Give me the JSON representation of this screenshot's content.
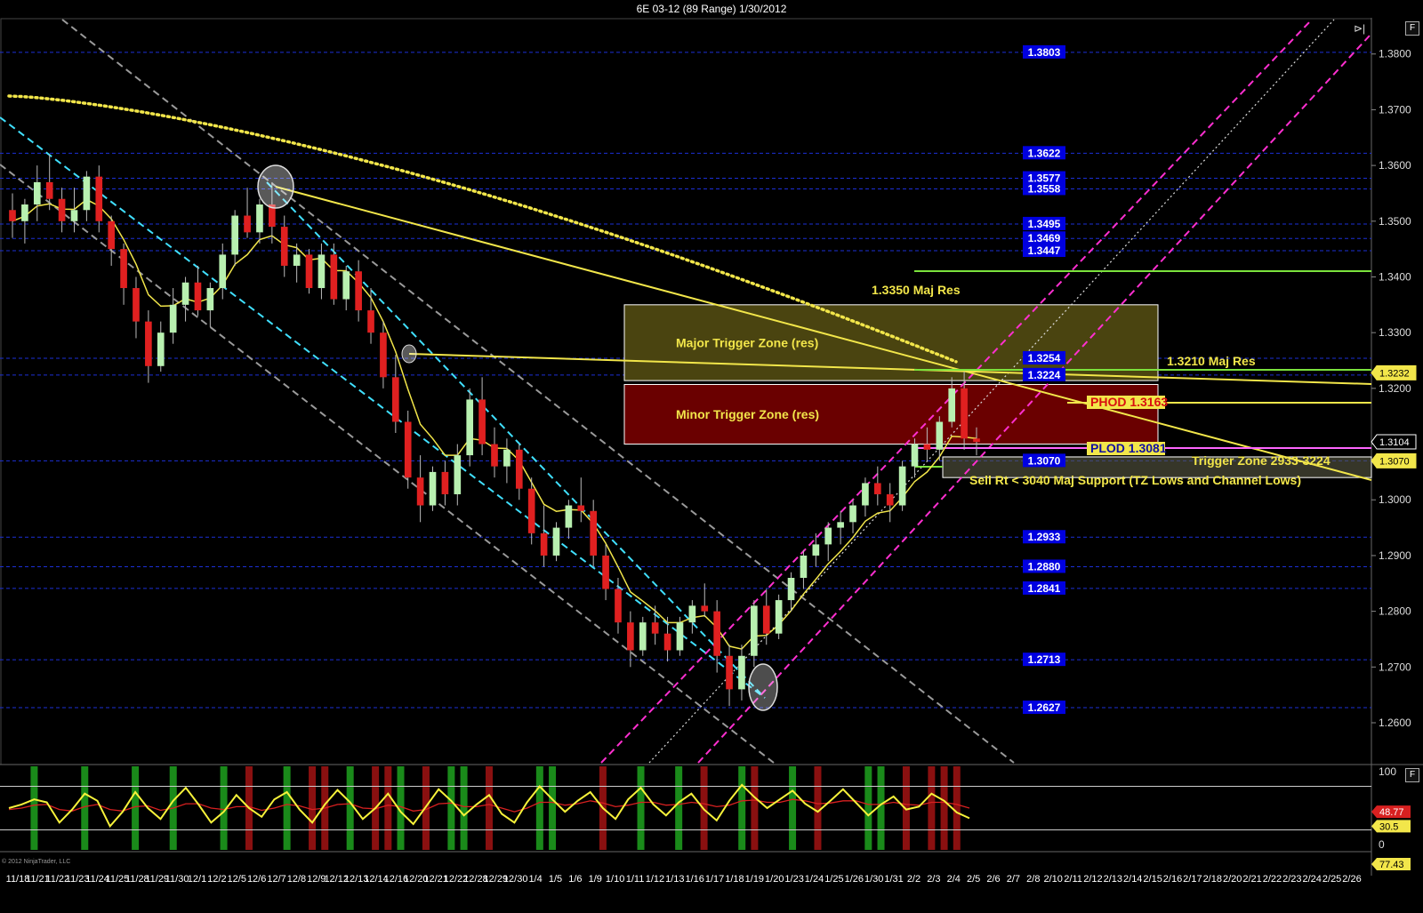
{
  "window": {
    "title": "6E 03-12 (89 Range)  1/30/2012",
    "f_button": "F",
    "copyright": "© 2012 NinjaTrader, LLC"
  },
  "colors": {
    "background": "#000000",
    "level_line": "#1c2fd6",
    "level_box": "#0000e0",
    "bull_candle": "#b8f0b0",
    "bear_candle": "#e02020",
    "sma_dotted": "#f2e64a",
    "ema_line": "#f2e64a",
    "channel_magenta": "#ff2fd0",
    "channel_cyan": "#40e0ff",
    "channel_gray": "#9a9a9a",
    "green_line": "#7be23c",
    "major_zone": "#4a4410",
    "minor_zone": "#6a0000",
    "osc_yellow": "#f7f23a",
    "osc_red": "#d82020",
    "osc_bar_green": "#1a8a1a",
    "osc_bar_red": "#8a1010"
  },
  "chart_data": {
    "type": "candlestick",
    "instrument": "6E 03-12",
    "ylim": [
      1.2525,
      1.3865
    ],
    "y_ticks": [
      "1.3800",
      "1.3700",
      "1.3600",
      "1.3500",
      "1.3400",
      "1.3300",
      "1.3200",
      "1.3100",
      "1.3000",
      "1.2900",
      "1.2800",
      "1.2700",
      "1.2600"
    ],
    "x_labels": [
      "11/18",
      "11/21",
      "11/22",
      "11/23",
      "11/24",
      "11/25",
      "11/28",
      "11/29",
      "11/30",
      "12/1",
      "12/2",
      "12/5",
      "12/6",
      "12/7",
      "12/8",
      "12/9",
      "12/12",
      "12/13",
      "12/14",
      "12/16",
      "12/20",
      "12/21",
      "12/22",
      "12/28",
      "12/29",
      "12/30",
      "1/4",
      "1/5",
      "1/6",
      "1/9",
      "1/10",
      "1/11",
      "1/12",
      "1/13",
      "1/16",
      "1/17",
      "1/18",
      "1/19",
      "1/20",
      "1/23",
      "1/24",
      "1/25",
      "1/26",
      "1/30",
      "1/31",
      "2/2",
      "2/3",
      "2/4",
      "2/5",
      "2/6",
      "2/7",
      "2/8",
      "2/10",
      "2/11",
      "2/12",
      "2/13",
      "2/14",
      "2/15",
      "2/16",
      "2/17",
      "2/18",
      "2/20",
      "2/21",
      "2/22",
      "2/23",
      "2/24",
      "2/25",
      "2/26"
    ],
    "levels": [
      {
        "label": "1.3803",
        "value": 1.3803
      },
      {
        "label": "1.3622",
        "value": 1.3622
      },
      {
        "label": "1.3577",
        "value": 1.3577
      },
      {
        "label": "1.3558",
        "value": 1.3558
      },
      {
        "label": "1.3495",
        "value": 1.3495
      },
      {
        "label": "1.3469",
        "value": 1.3469
      },
      {
        "label": "1.3447",
        "value": 1.3447
      },
      {
        "label": "1.3254",
        "value": 1.3254
      },
      {
        "label": "1.3224",
        "value": 1.3224
      },
      {
        "label": "1.3070",
        "value": 1.307
      },
      {
        "label": "1.2933",
        "value": 1.2933
      },
      {
        "label": "1.2880",
        "value": 1.288
      },
      {
        "label": "1.2841",
        "value": 1.2841
      },
      {
        "label": "1.2713",
        "value": 1.2713
      },
      {
        "label": "1.2627",
        "value": 1.2627
      }
    ],
    "price_tags": [
      {
        "label": "1.3232",
        "value": 1.3228,
        "style": "yellow"
      },
      {
        "label": "1.3104",
        "value": 1.3104,
        "style": "white"
      },
      {
        "label": "1.3070",
        "value": 1.307,
        "style": "yellow"
      }
    ],
    "zones": [
      {
        "label": "Major Trigger Zone (res)",
        "top": 1.335,
        "bottom": 1.3214
      },
      {
        "label": "Minor Trigger Zone (res)",
        "top": 1.3207,
        "bottom": 1.31
      }
    ],
    "annotations": {
      "maj_res_1": "1.3350 Maj Res",
      "maj_res_2": "1.3210 Maj Res",
      "phod": "PHOD 1.3163",
      "plod": "PLOD 1.3081",
      "trigger_zone": "Trigger Zone 2933-3224",
      "sell_note": "Sell Rt < 3040 Maj Support (TZ Lows and Channel Lows)"
    },
    "candles": [
      [
        1.352,
        1.355,
        1.347,
        1.35
      ],
      [
        1.35,
        1.354,
        1.346,
        1.353
      ],
      [
        1.353,
        1.36,
        1.35,
        1.357
      ],
      [
        1.357,
        1.362,
        1.352,
        1.354
      ],
      [
        1.354,
        1.356,
        1.348,
        1.35
      ],
      [
        1.35,
        1.356,
        1.348,
        1.352
      ],
      [
        1.352,
        1.359,
        1.35,
        1.358
      ],
      [
        1.358,
        1.36,
        1.348,
        1.35
      ],
      [
        1.35,
        1.351,
        1.342,
        1.345
      ],
      [
        1.345,
        1.346,
        1.335,
        1.338
      ],
      [
        1.338,
        1.34,
        1.329,
        1.332
      ],
      [
        1.332,
        1.334,
        1.321,
        1.324
      ],
      [
        1.324,
        1.332,
        1.323,
        1.33
      ],
      [
        1.33,
        1.338,
        1.328,
        1.335
      ],
      [
        1.335,
        1.34,
        1.332,
        1.339
      ],
      [
        1.339,
        1.342,
        1.333,
        1.334
      ],
      [
        1.334,
        1.339,
        1.331,
        1.338
      ],
      [
        1.338,
        1.346,
        1.336,
        1.344
      ],
      [
        1.344,
        1.352,
        1.342,
        1.351
      ],
      [
        1.351,
        1.356,
        1.347,
        1.348
      ],
      [
        1.348,
        1.354,
        1.346,
        1.353
      ],
      [
        1.353,
        1.357,
        1.346,
        1.349
      ],
      [
        1.349,
        1.351,
        1.34,
        1.342
      ],
      [
        1.342,
        1.346,
        1.339,
        1.344
      ],
      [
        1.344,
        1.345,
        1.337,
        1.338
      ],
      [
        1.338,
        1.346,
        1.336,
        1.344
      ],
      [
        1.344,
        1.346,
        1.335,
        1.336
      ],
      [
        1.336,
        1.342,
        1.334,
        1.341
      ],
      [
        1.341,
        1.343,
        1.332,
        1.334
      ],
      [
        1.334,
        1.338,
        1.328,
        1.33
      ],
      [
        1.33,
        1.332,
        1.32,
        1.322
      ],
      [
        1.322,
        1.326,
        1.312,
        1.314
      ],
      [
        1.314,
        1.316,
        1.302,
        1.304
      ],
      [
        1.304,
        1.308,
        1.296,
        1.299
      ],
      [
        1.299,
        1.306,
        1.298,
        1.305
      ],
      [
        1.305,
        1.307,
        1.299,
        1.301
      ],
      [
        1.301,
        1.31,
        1.299,
        1.308
      ],
      [
        1.308,
        1.32,
        1.306,
        1.318
      ],
      [
        1.318,
        1.322,
        1.308,
        1.31
      ],
      [
        1.31,
        1.313,
        1.304,
        1.306
      ],
      [
        1.306,
        1.311,
        1.303,
        1.309
      ],
      [
        1.309,
        1.31,
        1.3,
        1.302
      ],
      [
        1.302,
        1.304,
        1.292,
        1.294
      ],
      [
        1.294,
        1.299,
        1.288,
        1.29
      ],
      [
        1.29,
        1.296,
        1.289,
        1.295
      ],
      [
        1.295,
        1.3,
        1.293,
        1.299
      ],
      [
        1.299,
        1.304,
        1.296,
        1.298
      ],
      [
        1.298,
        1.3,
        1.288,
        1.29
      ],
      [
        1.29,
        1.292,
        1.282,
        1.284
      ],
      [
        1.284,
        1.286,
        1.276,
        1.278
      ],
      [
        1.278,
        1.28,
        1.27,
        1.273
      ],
      [
        1.273,
        1.279,
        1.272,
        1.278
      ],
      [
        1.278,
        1.281,
        1.274,
        1.276
      ],
      [
        1.276,
        1.279,
        1.271,
        1.273
      ],
      [
        1.273,
        1.279,
        1.272,
        1.278
      ],
      [
        1.278,
        1.282,
        1.276,
        1.281
      ],
      [
        1.281,
        1.285,
        1.279,
        1.28
      ],
      [
        1.28,
        1.282,
        1.269,
        1.272
      ],
      [
        1.272,
        1.274,
        1.263,
        1.266
      ],
      [
        1.266,
        1.274,
        1.264,
        1.272
      ],
      [
        1.272,
        1.282,
        1.27,
        1.281
      ],
      [
        1.281,
        1.284,
        1.274,
        1.276
      ],
      [
        1.276,
        1.283,
        1.275,
        1.282
      ],
      [
        1.282,
        1.287,
        1.28,
        1.286
      ],
      [
        1.286,
        1.291,
        1.284,
        1.29
      ],
      [
        1.29,
        1.294,
        1.288,
        1.292
      ],
      [
        1.292,
        1.296,
        1.289,
        1.295
      ],
      [
        1.295,
        1.298,
        1.292,
        1.296
      ],
      [
        1.296,
        1.3,
        1.294,
        1.299
      ],
      [
        1.299,
        1.304,
        1.297,
        1.303
      ],
      [
        1.303,
        1.306,
        1.299,
        1.301
      ],
      [
        1.301,
        1.303,
        1.296,
        1.299
      ],
      [
        1.299,
        1.307,
        1.298,
        1.306
      ],
      [
        1.306,
        1.311,
        1.304,
        1.31
      ],
      [
        1.31,
        1.313,
        1.307,
        1.309
      ],
      [
        1.309,
        1.315,
        1.307,
        1.314
      ],
      [
        1.314,
        1.322,
        1.313,
        1.32
      ],
      [
        1.32,
        1.323,
        1.309,
        1.311
      ],
      [
        1.311,
        1.313,
        1.308,
        1.3104
      ]
    ],
    "oscillator": {
      "ylim": [
        -10,
        110
      ],
      "ticks": [
        "100",
        "0"
      ],
      "levels": [
        80,
        20
      ],
      "tags": [
        {
          "label": "48.77",
          "style": "red"
        },
        {
          "label": "30.5",
          "style": "yellow"
        },
        {
          "label": "77.43",
          "style": "yellow"
        }
      ],
      "yellow": [
        50,
        55,
        62,
        58,
        30,
        48,
        70,
        60,
        25,
        45,
        72,
        50,
        35,
        60,
        78,
        55,
        30,
        45,
        68,
        50,
        38,
        62,
        72,
        48,
        30,
        55,
        75,
        58,
        35,
        50,
        70,
        45,
        28,
        52,
        76,
        60,
        40,
        55,
        68,
        42,
        30,
        58,
        80,
        62,
        45,
        60,
        72,
        50,
        35,
        62,
        78,
        55,
        40,
        58,
        70,
        48,
        33,
        60,
        82,
        65,
        50,
        62,
        74,
        56,
        45,
        60,
        76,
        58,
        40,
        55,
        66,
        48,
        52,
        70,
        60,
        44,
        36
      ],
      "red": [
        48,
        50,
        54,
        55,
        48,
        46,
        52,
        55,
        48,
        46,
        52,
        53,
        47,
        50,
        56,
        56,
        50,
        48,
        52,
        52,
        47,
        50,
        55,
        53,
        48,
        50,
        55,
        56,
        50,
        49,
        54,
        52,
        46,
        48,
        56,
        57,
        52,
        52,
        55,
        50,
        45,
        50,
        58,
        58,
        54,
        56,
        60,
        57,
        52,
        54,
        58,
        58,
        54,
        55,
        58,
        56,
        52,
        54,
        60,
        61,
        58,
        58,
        62,
        60,
        56,
        57,
        60,
        60,
        55,
        55,
        58,
        55,
        54,
        58,
        58,
        55,
        50
      ],
      "bars": [
        {
          "i": 2,
          "c": "g"
        },
        {
          "i": 6,
          "c": "g"
        },
        {
          "i": 10,
          "c": "g"
        },
        {
          "i": 13,
          "c": "g"
        },
        {
          "i": 17,
          "c": "g"
        },
        {
          "i": 19,
          "c": "r"
        },
        {
          "i": 22,
          "c": "g"
        },
        {
          "i": 24,
          "c": "r"
        },
        {
          "i": 25,
          "c": "r"
        },
        {
          "i": 27,
          "c": "g"
        },
        {
          "i": 29,
          "c": "r"
        },
        {
          "i": 30,
          "c": "r"
        },
        {
          "i": 31,
          "c": "g"
        },
        {
          "i": 33,
          "c": "r"
        },
        {
          "i": 35,
          "c": "g"
        },
        {
          "i": 36,
          "c": "g"
        },
        {
          "i": 38,
          "c": "r"
        },
        {
          "i": 42,
          "c": "g"
        },
        {
          "i": 43,
          "c": "g"
        },
        {
          "i": 47,
          "c": "r"
        },
        {
          "i": 50,
          "c": "g"
        },
        {
          "i": 53,
          "c": "g"
        },
        {
          "i": 55,
          "c": "r"
        },
        {
          "i": 58,
          "c": "g"
        },
        {
          "i": 59,
          "c": "r"
        },
        {
          "i": 62,
          "c": "g"
        },
        {
          "i": 64,
          "c": "r"
        },
        {
          "i": 68,
          "c": "g"
        },
        {
          "i": 69,
          "c": "g"
        },
        {
          "i": 71,
          "c": "r"
        },
        {
          "i": 73,
          "c": "r"
        },
        {
          "i": 74,
          "c": "r"
        },
        {
          "i": 75,
          "c": "r"
        }
      ]
    }
  }
}
